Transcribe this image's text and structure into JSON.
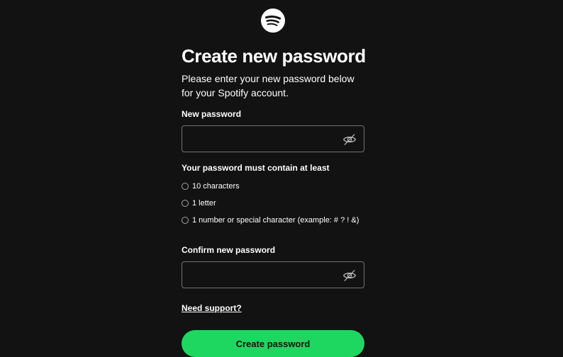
{
  "logo": {
    "icon": "spotify-logo-icon"
  },
  "heading": {
    "title": "Create new password",
    "subtitle": "Please enter your new password below for your Spotify account."
  },
  "new_password": {
    "label": "New password",
    "value": "",
    "visibility_icon": "eye-slash-icon"
  },
  "requirements": {
    "title": "Your password must contain at least",
    "items": [
      {
        "label": "10 characters",
        "met": false
      },
      {
        "label": "1 letter",
        "met": false
      },
      {
        "label": "1 number or special character (example: # ? ! &)",
        "met": false
      }
    ]
  },
  "confirm_password": {
    "label": "Confirm new password",
    "value": "",
    "visibility_icon": "eye-slash-icon"
  },
  "support_link": {
    "label": "Need support?"
  },
  "submit_button": {
    "label": "Create password"
  },
  "colors": {
    "background": "#121212",
    "accent": "#1ed760",
    "border": "#727272",
    "text": "#ffffff"
  }
}
